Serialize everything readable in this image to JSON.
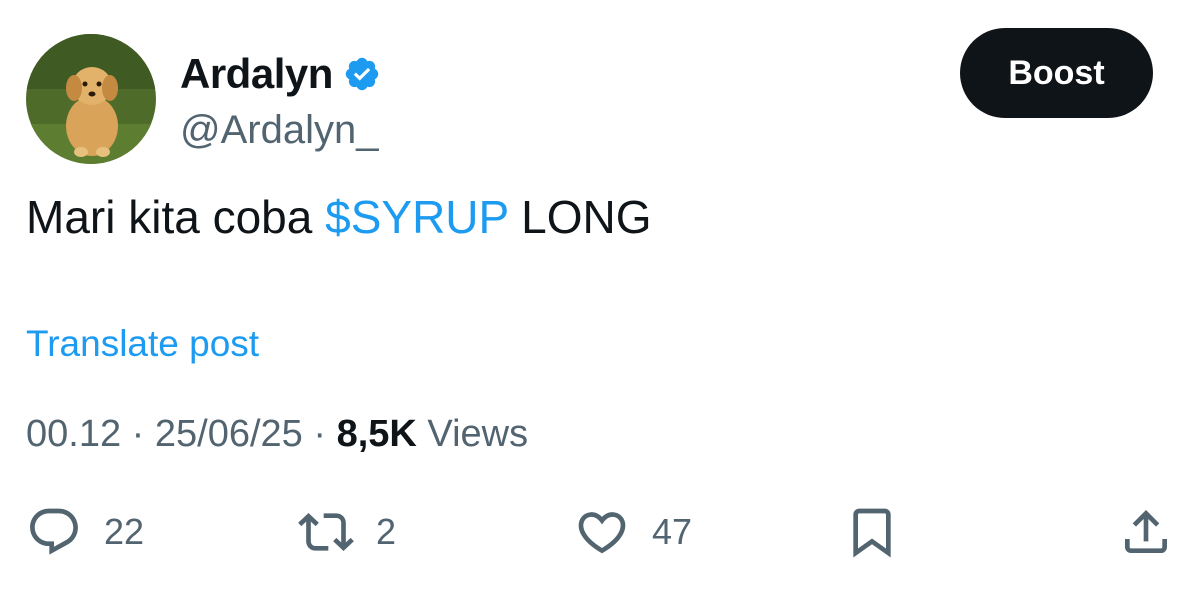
{
  "author": {
    "display_name": "Ardalyn",
    "handle": "@Ardalyn_",
    "verified": true
  },
  "header": {
    "boost_label": "Boost"
  },
  "post": {
    "text_before": "Mari kita coba ",
    "cashtag": "$SYRUP",
    "text_after": " LONG",
    "translate_label": "Translate post"
  },
  "meta": {
    "time": "00.12",
    "separator": " · ",
    "date": "25/06/25",
    "views_count": "8,5K",
    "views_label": " Views"
  },
  "actions": {
    "replies": "22",
    "reposts": "2",
    "likes": "47"
  },
  "icons": {
    "verified": "verified-badge-icon",
    "reply": "reply-icon",
    "repost": "repost-icon",
    "like": "heart-icon",
    "bookmark": "bookmark-icon",
    "share": "share-icon"
  },
  "colors": {
    "accent": "#1d9bf0",
    "text": "#0f1419",
    "muted": "#536471",
    "button_bg": "#0f1419"
  }
}
